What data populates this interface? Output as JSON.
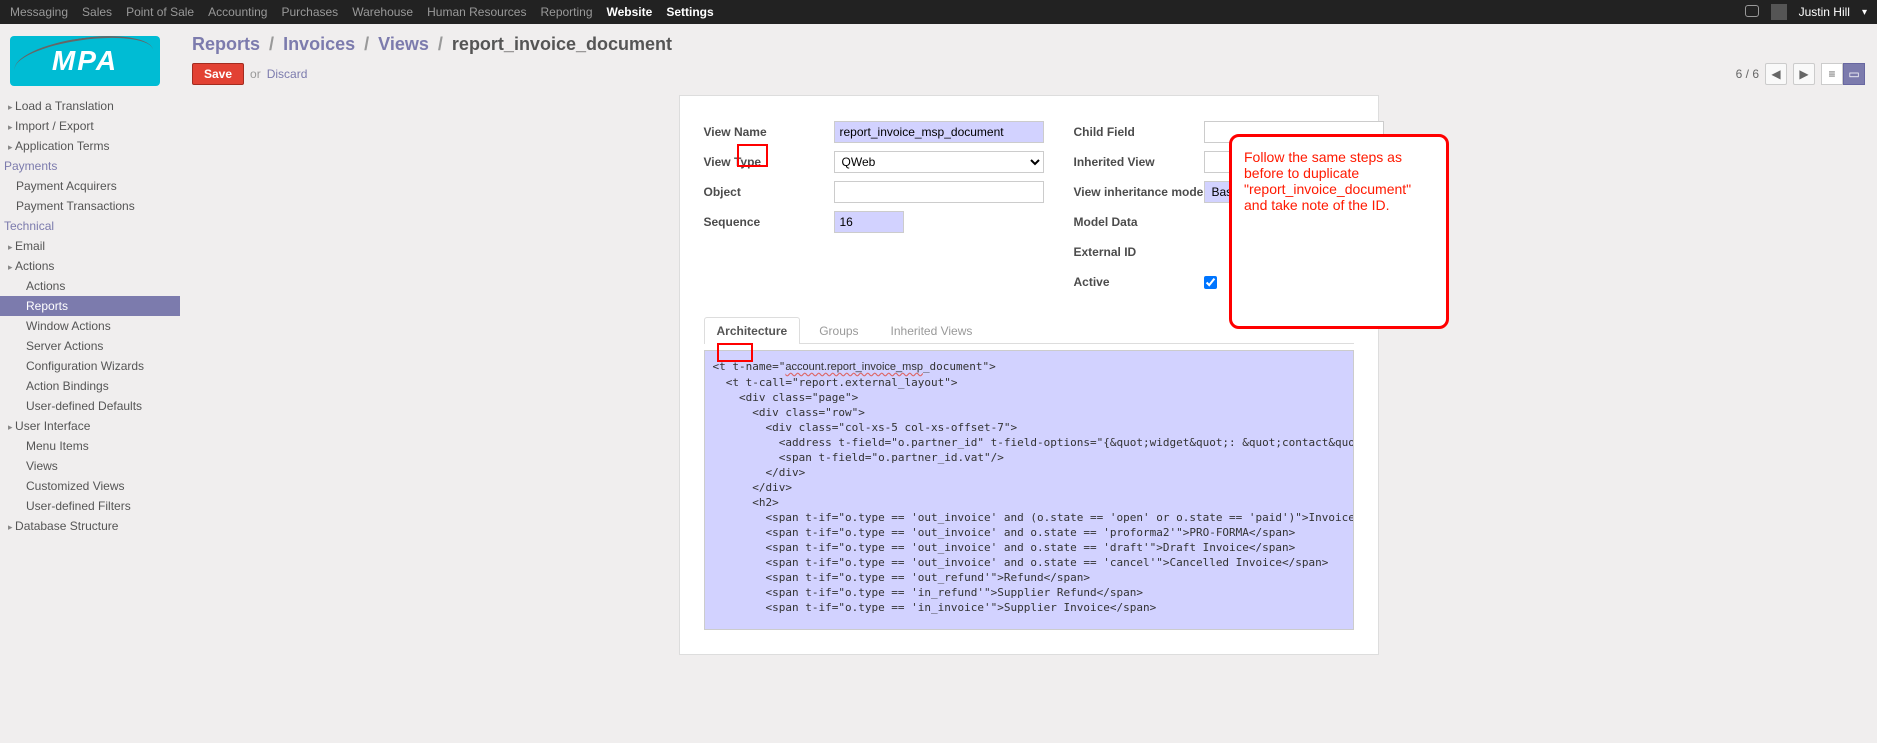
{
  "navbar": {
    "left": [
      "Messaging",
      "Sales",
      "Point of Sale",
      "Accounting",
      "Purchases",
      "Warehouse",
      "Human Resources",
      "Reporting",
      "Website",
      "Settings"
    ],
    "active": [
      "Website",
      "Settings"
    ],
    "user": "Justin Hill"
  },
  "sidebar": {
    "top": [
      "Load a Translation",
      "Import / Export",
      "Application Terms"
    ],
    "payments": {
      "title": "Payments",
      "items": [
        "Payment Acquirers",
        "Payment Transactions"
      ]
    },
    "technical": {
      "title": "Technical",
      "email": "Email",
      "actions": "Actions",
      "actions_children": [
        "Actions",
        "Reports",
        "Window Actions",
        "Server Actions",
        "Configuration Wizards",
        "Action Bindings",
        "User-defined Defaults"
      ],
      "active": "Reports",
      "ui": "User Interface",
      "ui_children": [
        "Menu Items",
        "Views",
        "Customized Views",
        "User-defined Filters"
      ],
      "db": "Database Structure"
    }
  },
  "breadcrumb": {
    "a": "Reports",
    "b": "Invoices",
    "c": "Views",
    "d": "report_invoice_document"
  },
  "toolbar": {
    "save": "Save",
    "or": "or",
    "discard": "Discard",
    "pager": "6 / 6"
  },
  "form": {
    "labels": {
      "view_name": "View Name",
      "view_type": "View Type",
      "object": "Object",
      "sequence": "Sequence",
      "child_field": "Child Field",
      "inherited_view": "Inherited View",
      "inh_mode": "View inheritance mode",
      "model_data": "Model Data",
      "ext_id": "External ID",
      "active": "Active"
    },
    "view_name": "report_invoice_msp_document",
    "view_type": "QWeb",
    "object": "",
    "sequence": "16",
    "child_field": "",
    "inherited_view": "",
    "inh_mode": "Base view",
    "active": true
  },
  "tabs": {
    "arch": "Architecture",
    "groups": "Groups",
    "inh": "Inherited Views"
  },
  "code_lines": [
    "<t t-name=\"account.report_invoice_msp_document\">",
    "  <t t-call=\"report.external_layout\">",
    "    <div class=\"page\">",
    "      <div class=\"row\">",
    "        <div class=\"col-xs-5 col-xs-offset-7\">",
    "          <address t-field=\"o.partner_id\" t-field-options=\"{&quot;widget&quot;: &quot;contact&quot;, &quot;fields&quot;: [&quot;address&quot;, &quot;name&quot;], &quot;no_marker&quot;: true}\"/>",
    "          <span t-field=\"o.partner_id.vat\"/>",
    "        </div>",
    "      </div>",
    "      <h2>",
    "        <span t-if=\"o.type == 'out_invoice' and (o.state == 'open' or o.state == 'paid')\">Invoice</span>",
    "        <span t-if=\"o.type == 'out_invoice' and o.state == 'proforma2'\">PRO-FORMA</span>",
    "        <span t-if=\"o.type == 'out_invoice' and o.state == 'draft'\">Draft Invoice</span>",
    "        <span t-if=\"o.type == 'out_invoice' and o.state == 'cancel'\">Cancelled Invoice</span>",
    "        <span t-if=\"o.type == 'out_refund'\">Refund</span>",
    "        <span t-if=\"o.type == 'in_refund'\">Supplier Refund</span>",
    "        <span t-if=\"o.type == 'in_invoice'\">Supplier Invoice</span>"
  ],
  "callout": "Follow the same steps as before to duplicate \"report_invoice_document\" and take note of the ID."
}
